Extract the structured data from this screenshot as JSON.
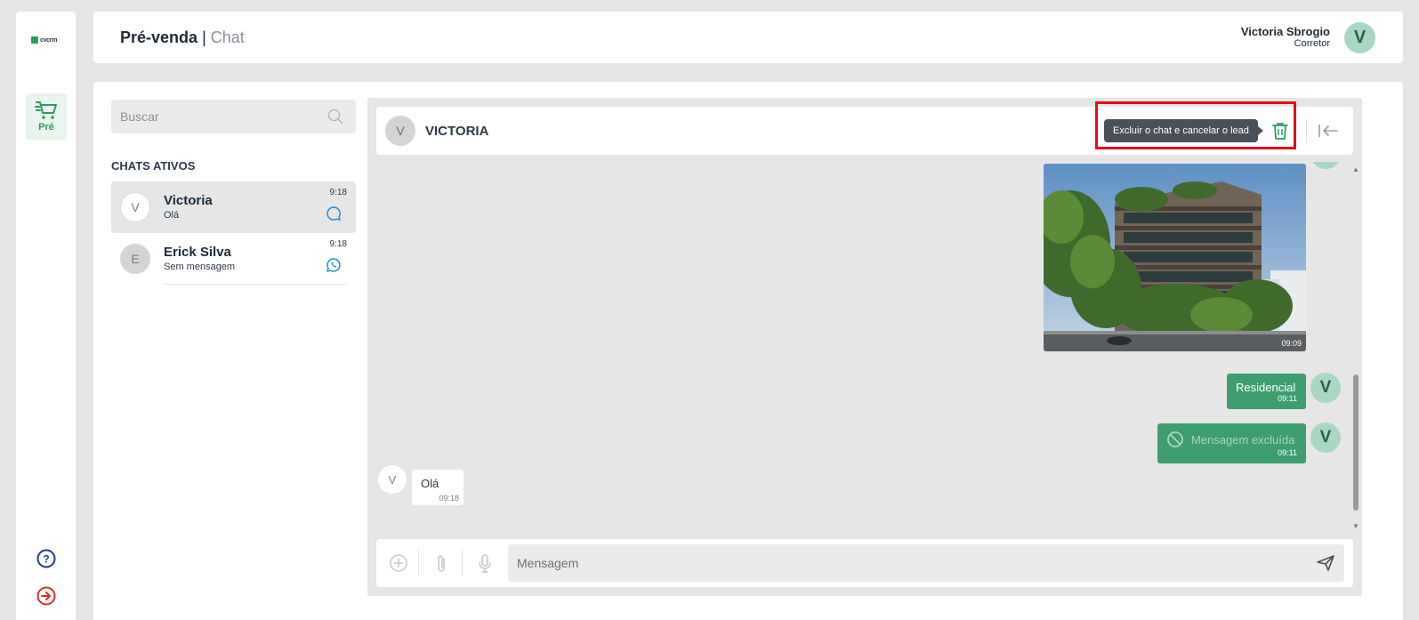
{
  "app": {
    "logo_text": "cvcrm",
    "nav": [
      {
        "label": "Pré",
        "icon": "cart-icon"
      }
    ]
  },
  "header": {
    "title": "Pré-venda",
    "separator": "|",
    "subtitle": "Chat",
    "user_name": "Victoria Sbrogio",
    "user_role": "Corretor",
    "avatar_letter": "V"
  },
  "sidebar": {
    "search_placeholder": "Buscar",
    "section_title": "CHATS ATIVOS",
    "chats": [
      {
        "initial": "V",
        "name": "Victoria",
        "preview": "Olá",
        "time": "9:18",
        "channel": "chat-icon"
      },
      {
        "initial": "E",
        "name": "Erick Silva",
        "preview": "Sem mensagem",
        "time": "9:18",
        "channel": "whatsapp-icon"
      }
    ]
  },
  "chat": {
    "contact_initial": "V",
    "contact_name": "VICTORIA",
    "tooltip": "Excluir o chat e cancelar o lead",
    "messages": {
      "image_time": "09:09",
      "out1_text": "Residencial",
      "out1_time": "09:11",
      "out2_text": "Mensagem excluída",
      "out2_time": "09:11",
      "out_avatar": "V",
      "in_initial": "V",
      "in_text": "Olá",
      "in_time": "09:18"
    },
    "composer_placeholder": "Mensagem"
  },
  "colors": {
    "accent": "#3e9e70",
    "highlight": "#e0101a",
    "avatar_bg": "#a9d8c2"
  }
}
